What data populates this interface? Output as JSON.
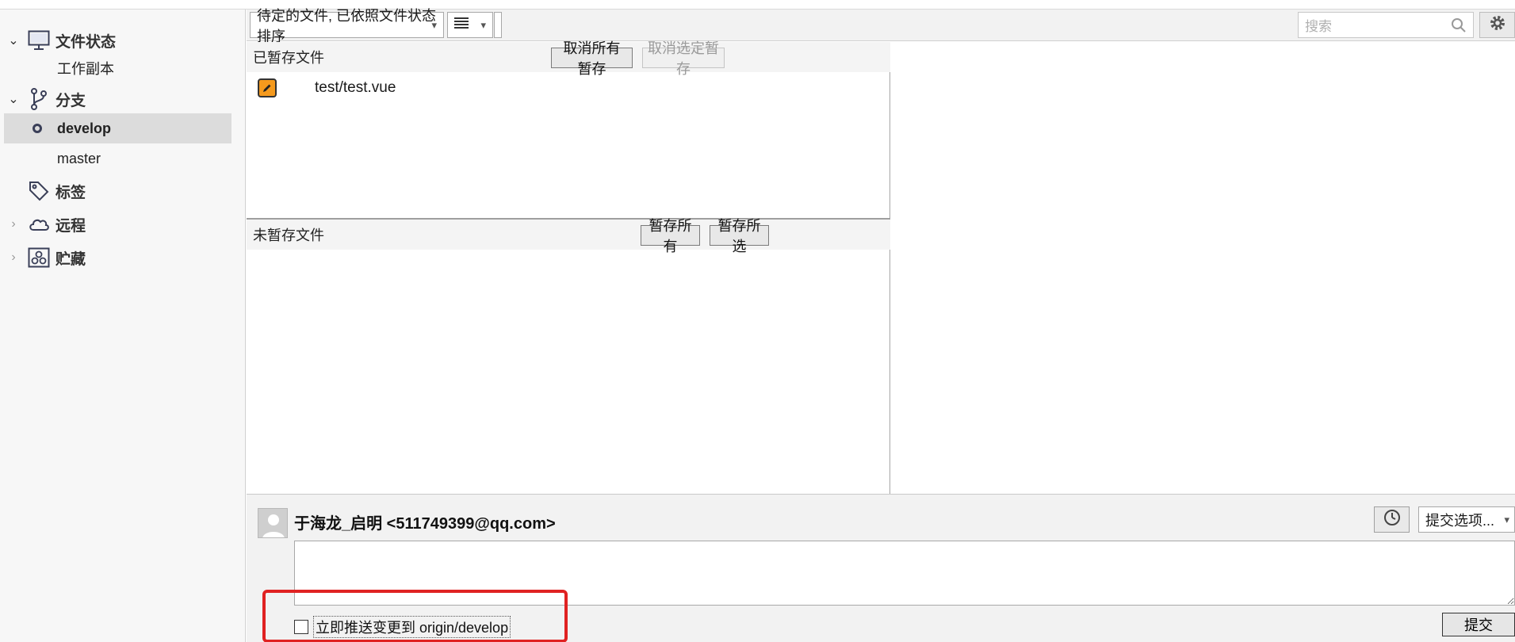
{
  "sidebar": {
    "workspace": {
      "label": "文件状态",
      "sub": "工作副本"
    },
    "branches": {
      "label": "分支",
      "items": [
        "develop",
        "master"
      ]
    },
    "tags": {
      "label": "标签"
    },
    "remotes": {
      "label": "远程"
    },
    "stashes": {
      "label": "贮藏"
    }
  },
  "toolbar": {
    "sort_select": "待定的文件, 已依照文件状态排序",
    "search_placeholder": "搜索"
  },
  "staged": {
    "title": "已暂存文件",
    "unstage_all": "取消所有暂存",
    "unstage_selected": "取消选定暂存",
    "files": [
      "test/test.vue"
    ]
  },
  "unstaged": {
    "title": "未暂存文件",
    "stage_all": "暂存所有",
    "stage_selected": "暂存所选"
  },
  "commit": {
    "author": "于海龙_启明 <511749399@qq.com>",
    "options_label": "提交选项...",
    "push_label": "立即推送变更到 origin/develop",
    "push_checked": false,
    "commit_button": "提交"
  }
}
